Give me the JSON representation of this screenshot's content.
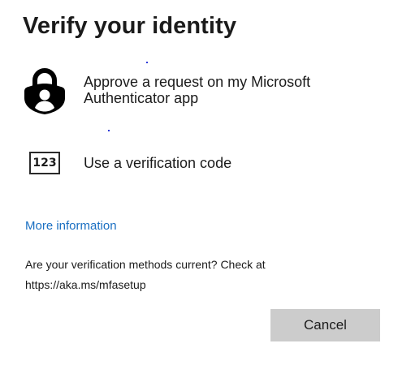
{
  "dialog": {
    "title": "Verify your identity"
  },
  "options": [
    {
      "label": "Approve a request on my Microsoft Authenticator app",
      "icon": "authenticator-lock-icon"
    },
    {
      "label": "Use a verification code",
      "icon": "verification-code-icon",
      "icon_text": "123"
    }
  ],
  "links": {
    "more_info": "More information"
  },
  "note": {
    "text": "Are your verification methods current? Check at https://aka.ms/mfasetup"
  },
  "buttons": {
    "cancel": "Cancel"
  },
  "colors": {
    "link": "#1a6fc2",
    "button_bg": "#cccccc",
    "text": "#1b1b1b"
  }
}
